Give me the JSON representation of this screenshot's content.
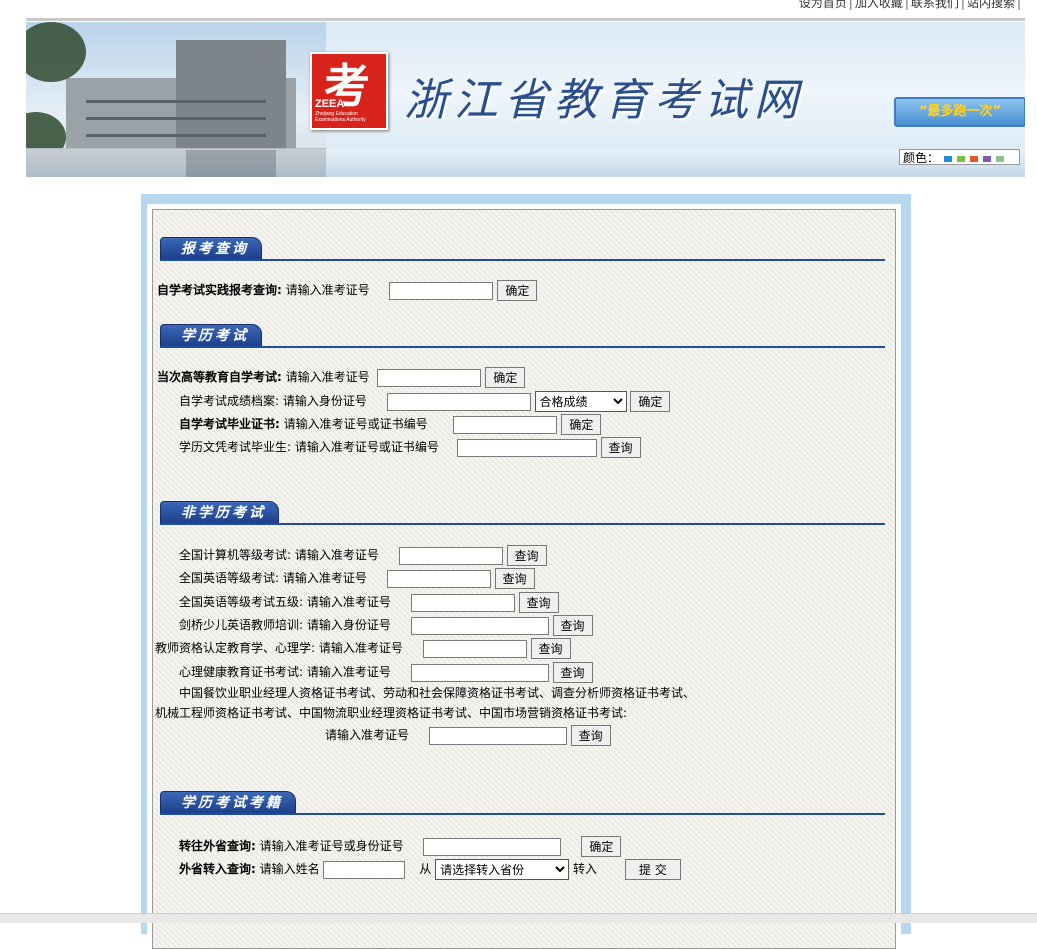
{
  "top_links": [
    "设为首页",
    "加入收藏",
    "联系我们",
    "站内搜索"
  ],
  "banner": {
    "site_title": "浙江省教育考试网",
    "logo_char": "考",
    "logo_en": "ZEEA",
    "logo_sub_1": "Zhejiang Education",
    "logo_sub_2": "Examinations Authority",
    "slogan": "“最多跑一次”",
    "color_label": "颜色：",
    "swatches": [
      "#1e90d8",
      "#7ac142",
      "#e8542a",
      "#7b5bb0",
      "#8fbf8f"
    ]
  },
  "sections": {
    "baokao": {
      "title": "报考查询",
      "row1": {
        "label": "自学考试实践报考查询:",
        "hint": "请输入准考证号",
        "button": "确定"
      }
    },
    "xueli": {
      "title": "学历考试",
      "row1": {
        "label": "当次高等教育自学考试:",
        "hint": "请输入准考证号",
        "button": "确定"
      },
      "row2": {
        "label": "自学考试成绩档案:",
        "hint": "请输入身份证号",
        "select": "合格成绩",
        "button": "确定"
      },
      "row3": {
        "label": "自学考试毕业证书:",
        "hint": "请输入准考证号或证书编号",
        "button": "确定"
      },
      "row4": {
        "label": "学历文凭考试毕业生:",
        "hint": "请输入准考证号或证书编号",
        "button": "查询"
      }
    },
    "feixueli": {
      "title": "非学历考试",
      "row1": {
        "label": "全国计算机等级考试:",
        "hint": "请输入准考证号",
        "button": "查询"
      },
      "row2": {
        "label": "全国英语等级考试:",
        "hint": "请输入准考证号",
        "button": "查询"
      },
      "row3": {
        "label": "全国英语等级考试五级:",
        "hint": "请输入准考证号",
        "button": "查询"
      },
      "row4": {
        "label": "剑桥少儿英语教师培训:",
        "hint": "请输入身份证号",
        "button": "查询"
      },
      "row5": {
        "label": "教师资格认定教育学、心理学:",
        "hint": "请输入准考证号",
        "button": "查询"
      },
      "row6": {
        "label": "心理健康教育证书考试:",
        "hint": "请输入准考证号",
        "button": "查询"
      },
      "row7a": "中国餐饮业职业经理人资格证书考试、劳动和社会保障资格证书考试、调查分析师资格证书考试、",
      "row7b": "机械工程师资格证书考试、中国物流职业经理资格证书考试、中国市场营销资格证书考试:",
      "row8": {
        "hint": "请输入准考证号",
        "button": "查询"
      }
    },
    "xuji": {
      "title": "学历考试考籍",
      "row1": {
        "label": "转往外省查询:",
        "hint": "请输入准考证号或身份证号",
        "button": "确定"
      },
      "row2": {
        "label": "外省转入查询:",
        "hint": "请输入姓名",
        "from": "从",
        "select": "请选择转入省份",
        "to": "转入",
        "button": "提 交"
      }
    }
  }
}
